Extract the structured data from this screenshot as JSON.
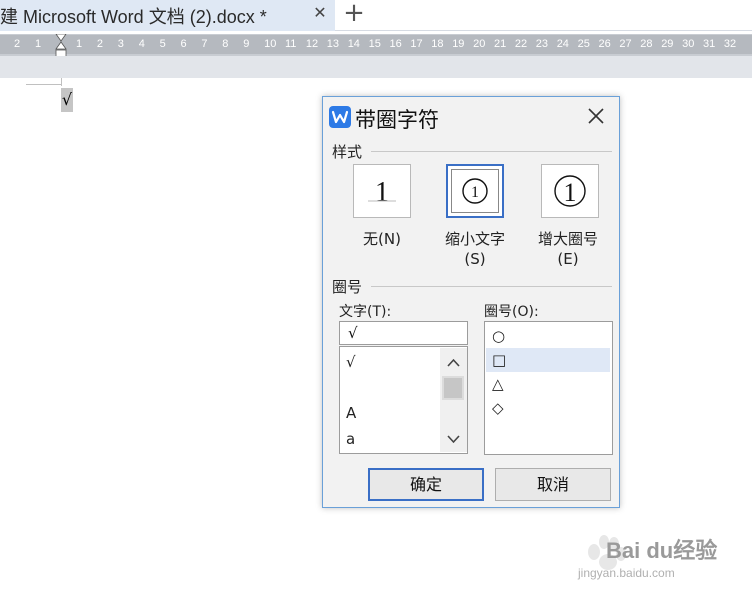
{
  "tab": {
    "title": "建 Microsoft Word 文档 (2).docx *",
    "close": "✕",
    "add": "+"
  },
  "ruler": {
    "ticks": [
      "2",
      "1",
      "1",
      "2",
      "3",
      "4",
      "5",
      "6",
      "7",
      "8",
      "9",
      "10",
      "11",
      "12",
      "13",
      "14",
      "15",
      "16",
      "17",
      "18",
      "19",
      "20",
      "21",
      "22",
      "23",
      "24",
      "25",
      "26",
      "27",
      "28",
      "29",
      "30",
      "31",
      "32"
    ]
  },
  "document": {
    "content": "√"
  },
  "dialog": {
    "title": "带圈字符",
    "style_section": "样式",
    "styles": [
      {
        "glyph": "1",
        "caption": "无(N)"
      },
      {
        "glyph": "1",
        "caption": "缩小文字(S)",
        "selected": true
      },
      {
        "glyph": "1",
        "caption": "增大圈号(E)"
      }
    ],
    "circle_section": "圈号",
    "text_label": "文字(T):",
    "shape_label": "圈号(O):",
    "text_value": "√",
    "text_list": [
      "√",
      "",
      "A",
      "a"
    ],
    "shape_list": [
      "○",
      "□",
      "△",
      "◇"
    ],
    "shape_selected_index": 1,
    "ok": "确定",
    "cancel": "取消"
  },
  "watermark": {
    "brand": "Bai du经验",
    "url": "jingyan.baidu.com"
  }
}
